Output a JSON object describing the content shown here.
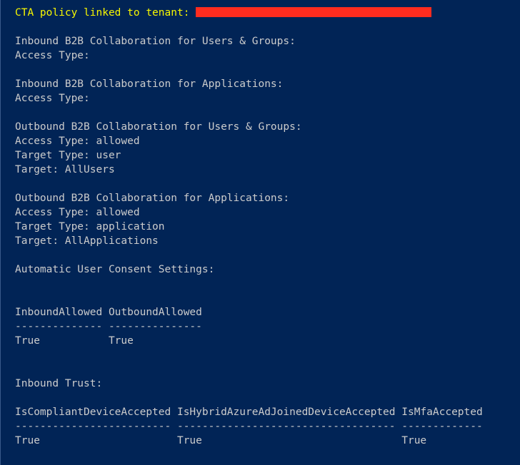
{
  "header": {
    "label": "CTA policy linked to tenant: "
  },
  "sections": {
    "inboundUsers": {
      "title": "Inbound B2B Collaboration for Users & Groups:",
      "accessTypeLabel": "Access Type:",
      "accessTypeValue": ""
    },
    "inboundApps": {
      "title": "Inbound B2B Collaboration for Applications:",
      "accessTypeLabel": "Access Type:",
      "accessTypeValue": ""
    },
    "outboundUsers": {
      "title": "Outbound B2B Collaboration for Users & Groups:",
      "accessTypeLine": "Access Type: allowed",
      "targetTypeLine": "Target Type: user",
      "targetLine": "Target: AllUsers"
    },
    "outboundApps": {
      "title": "Outbound B2B Collaboration for Applications:",
      "accessTypeLine": "Access Type: allowed",
      "targetTypeLine": "Target Type: application",
      "targetLine": "Target: AllApplications"
    },
    "consent": {
      "title": "Automatic User Consent Settings:",
      "header": "InboundAllowed OutboundAllowed",
      "divider": "-------------- ---------------",
      "row": "True           True"
    },
    "inboundTrust": {
      "title": "Inbound Trust:",
      "header": "IsCompliantDeviceAccepted IsHybridAzureAdJoinedDeviceAccepted IsMfaAccepted",
      "divider": "------------------------- ----------------------------------- -------------",
      "row": "True                      True                                True"
    }
  }
}
